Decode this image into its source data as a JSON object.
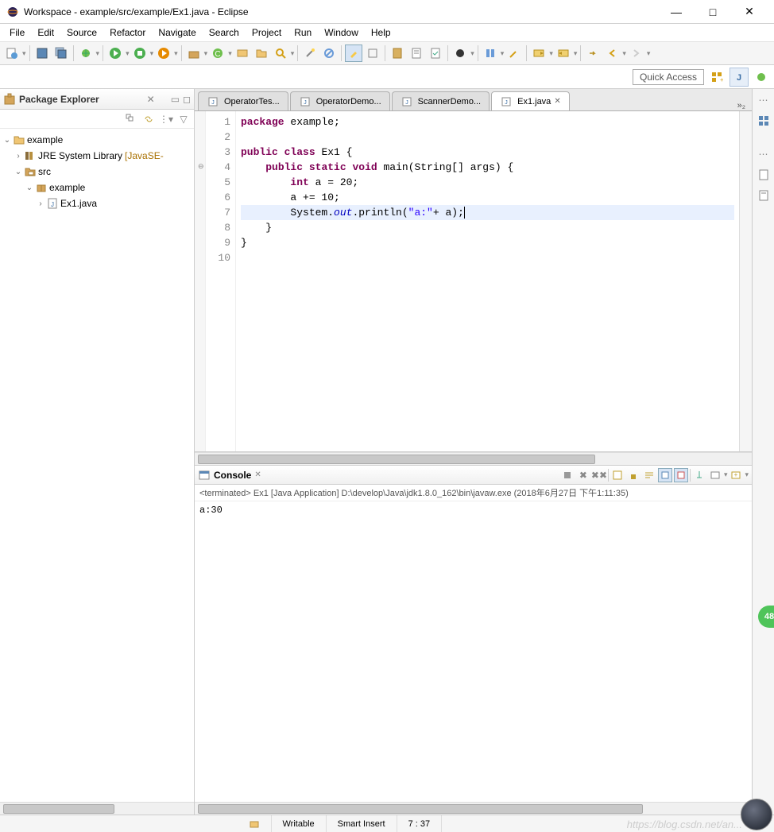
{
  "window": {
    "title": "Workspace - example/src/example/Ex1.java - Eclipse",
    "minimize": "—",
    "maximize": "□",
    "close": "✕"
  },
  "menu": [
    "File",
    "Edit",
    "Source",
    "Refactor",
    "Navigate",
    "Search",
    "Project",
    "Run",
    "Window",
    "Help"
  ],
  "quick_access": "Quick Access",
  "package_explorer": {
    "title": "Package Explorer",
    "items": {
      "project": "example",
      "jre": "JRE System Library",
      "jre_decor": "[JavaSE-",
      "src": "src",
      "pkg": "example",
      "file": "Ex1.java"
    }
  },
  "tabs": [
    {
      "label": "OperatorTes...",
      "active": false
    },
    {
      "label": "OperatorDemo...",
      "active": false
    },
    {
      "label": "ScannerDemo...",
      "active": false
    },
    {
      "label": "Ex1.java",
      "active": true
    }
  ],
  "tabs_more": "»₂",
  "code": {
    "lines": [
      "1",
      "2",
      "3",
      "4",
      "5",
      "6",
      "7",
      "8",
      "9",
      "10"
    ],
    "l1_kw1": "package",
    "l1_rest": " example;",
    "l3_kw1": "public",
    "l3_kw2": "class",
    "l3_rest": " Ex1 {",
    "l4_kw1": "public",
    "l4_kw2": "static",
    "l4_kw3": "void",
    "l4_rest": " main(String[] args) {",
    "l5_kw": "int",
    "l5_rest": " a = 20;",
    "l6": "        a += 10;",
    "l7_a": "        System.",
    "l7_fld": "out",
    "l7_b": ".println(",
    "l7_str": "\"a:\"",
    "l7_c": "+ a);",
    "l8": "    }",
    "l9": "}"
  },
  "console": {
    "title": "Console",
    "info": "<terminated> Ex1 [Java Application] D:\\develop\\Java\\jdk1.8.0_162\\bin\\javaw.exe (2018年6月27日 下午1:11:35)",
    "output": "a:30"
  },
  "status": {
    "writable": "Writable",
    "insert": "Smart Insert",
    "pos": "7 : 37"
  },
  "watermark": "https://blog.csdn.net/an...",
  "badge": "48"
}
